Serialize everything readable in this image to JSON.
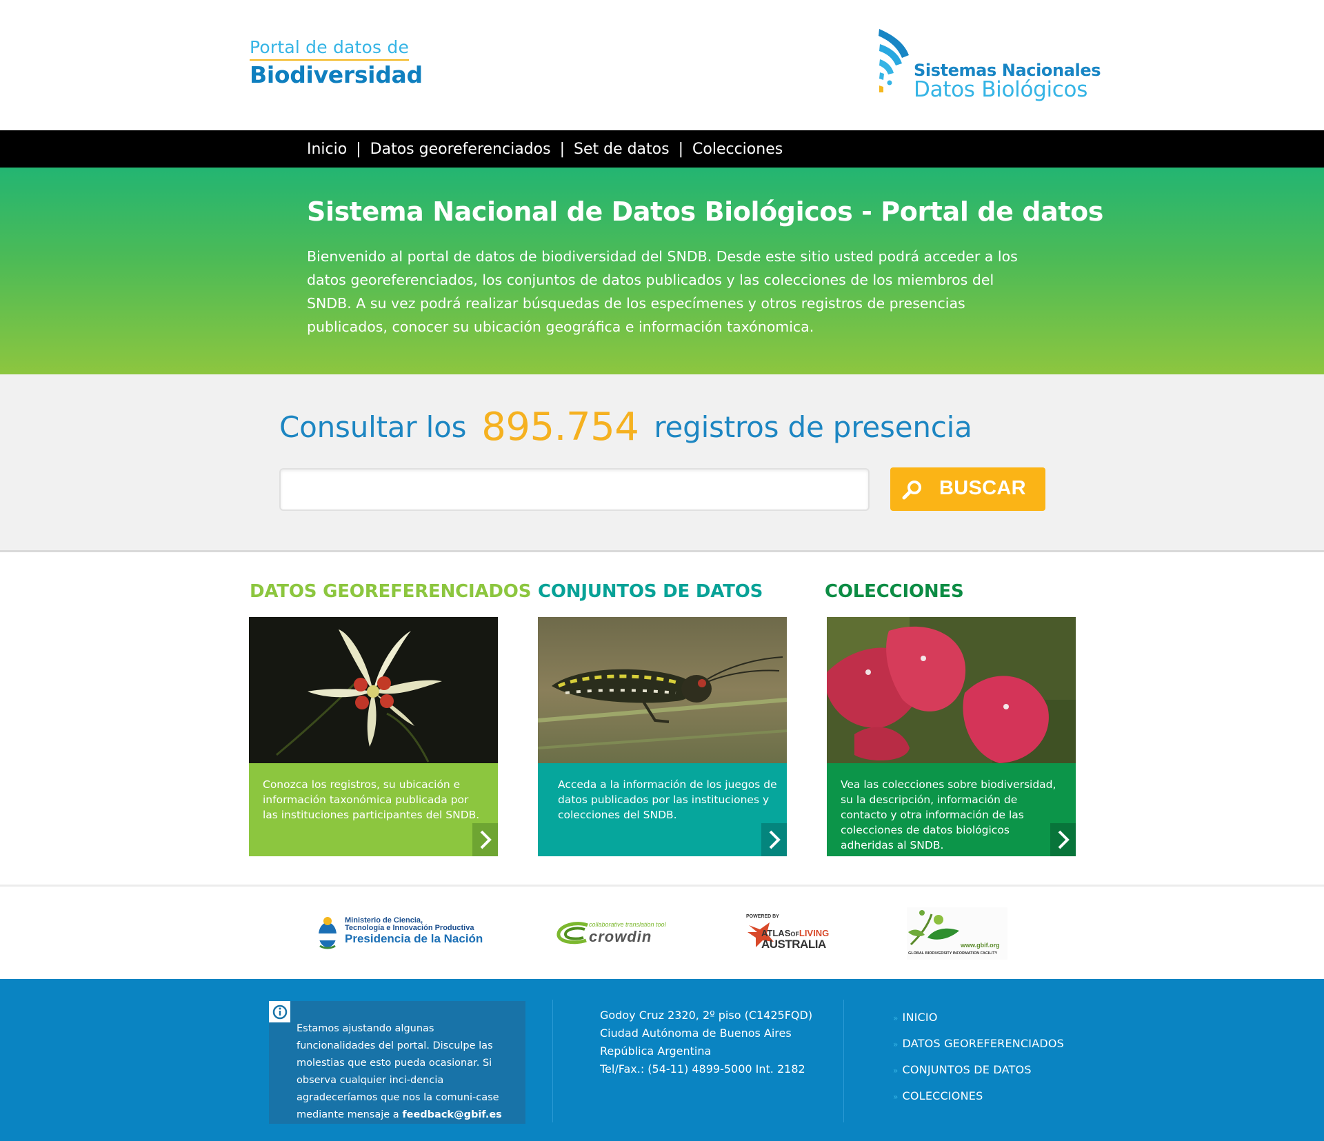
{
  "header": {
    "brand_small": "Portal de datos de",
    "brand_big": "Biodiversidad",
    "sndb_title": "Sistemas Nacionales",
    "sndb_sub": "Datos Biológicos"
  },
  "nav": {
    "items": [
      {
        "label": "Inicio"
      },
      {
        "label": "Datos georeferenciados"
      },
      {
        "label": "Set de datos"
      },
      {
        "label": "Colecciones"
      }
    ],
    "separator": "|"
  },
  "hero": {
    "title": "Sistema Nacional de Datos Biológicos - Portal de datos",
    "text": "Bienvenido al portal de datos de biodiversidad del SNDB. Desde este sitio usted podrá acceder a los datos georeferenciados, los conjuntos de datos publicados y las colecciones de los miembros del SNDB. A su vez podrá realizar búsquedas de los especímenes y otros registros de presencias publicados, conocer su ubicación geográfica e información taxónomica."
  },
  "search": {
    "prefix": "Consultar los",
    "count": "895.754",
    "suffix": "registros de presencia",
    "input_value": "",
    "button_label": "BUSCAR"
  },
  "cards": [
    {
      "heading": "DATOS GEOREFERENCIADOS",
      "text": "Conozca los registros, su ubicación e información taxonómica publicada por las instituciones participantes del SNDB.",
      "color": "#8cc63f",
      "heading_color": "#8cc63f"
    },
    {
      "heading": "CONJUNTOS DE DATOS",
      "text": "Acceda a la información de los juegos de datos publicados por las instituciones y colecciones del SNDB.",
      "color": "#06a69c",
      "heading_color": "#07a297"
    },
    {
      "heading": "COLECCIONES",
      "text": "Vea las colecciones sobre biodiversidad, su la descripción, información de contacto y otra información de las colecciones de datos biológicos adheridas al SNDB.",
      "color": "#0c9549",
      "heading_color": "#0c8c44"
    }
  ],
  "partners": {
    "mincyt_line1": "Ministerio de Ciencia,",
    "mincyt_line2": "Tecnología e Innovación Productiva",
    "mincyt_line3": "Presidencia de la Nación",
    "crowdin_tag": "collaborative translation tool",
    "crowdin_name": "crowdin",
    "ala_powered": "POWERED BY",
    "ala_atlas": "ATLAS",
    "ala_of": "OF",
    "ala_living": "LIVING",
    "ala_australia": "AUSTRALIA",
    "gbif_url": "www.gbif.org",
    "gbif_name": "GLOBAL BIODIVERSITY INFORMATION FACILITY"
  },
  "footer": {
    "notice_text": "Estamos ajustando algunas funcionalidades del portal. Disculpe las molestias que esto pueda ocasionar. Si observa cualquier inci-dencia agradeceríamos que nos la comuni-case mediante mensaje a",
    "notice_email": "feedback@gbif.es",
    "address": [
      "Godoy Cruz 2320, 2º piso (C1425FQD)",
      "Ciudad Autónoma de Buenos Aires",
      "República Argentina",
      "Tel/Fax.: (54-11) 4899-5000 Int. 2182"
    ],
    "links": [
      {
        "label": "INICIO"
      },
      {
        "label": "DATOS GEOREFERENCIADOS"
      },
      {
        "label": "CONJUNTOS DE DATOS"
      },
      {
        "label": "COLECCIONES"
      }
    ],
    "bullet": "»"
  },
  "colors": {
    "nav_bg": "#000000",
    "accent_blue": "#0a84c2",
    "accent_yellow": "#fbb416",
    "hero_green_top": "#23b572",
    "hero_green_bottom": "#8dc63f"
  }
}
